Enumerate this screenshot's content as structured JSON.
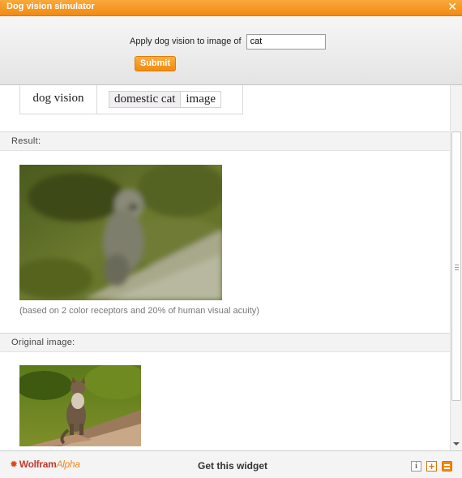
{
  "window": {
    "title": "Dog vision simulator",
    "close_glyph": "✕"
  },
  "form": {
    "label": "Apply dog vision to image of",
    "input_value": "cat",
    "submit_label": "Submit"
  },
  "interpretation": {
    "function": "dog vision",
    "chips": [
      "domestic cat",
      "image"
    ]
  },
  "result": {
    "header": "Result:",
    "caption": "(based on 2 color receptors and 20% of human visual acuity)"
  },
  "original": {
    "header": "Original image:"
  },
  "footer": {
    "logo_text": "Wolfram",
    "logo_alpha": "Alpha",
    "get_widget": "Get this widget",
    "info_glyph": "i",
    "add_glyph": "+"
  },
  "colors": {
    "accent": "#f28a12",
    "header_bg": "#f3f3f3"
  },
  "icons": [
    "close-icon",
    "info-icon",
    "add-icon",
    "menu-icon",
    "wolfram-star-icon"
  ]
}
